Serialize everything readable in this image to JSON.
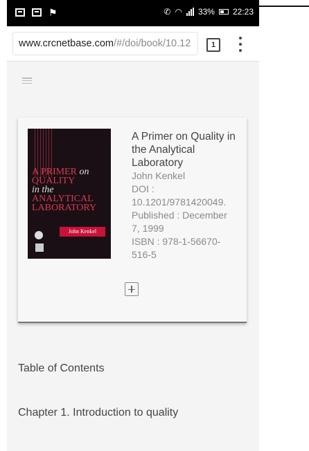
{
  "status_bar": {
    "battery": "33%",
    "time": "22:23",
    "icons": [
      "screen-icon",
      "mail-icon",
      "flag-icon",
      "phone-icon",
      "wifi-icon",
      "signal-icon",
      "battery-icon"
    ]
  },
  "browser": {
    "url_host": "www.crcnetbase.com",
    "url_path": "/#/doi/book/10.12",
    "tab_count": "1",
    "icons": [
      "menu-icon"
    ]
  },
  "book": {
    "title": "A Primer on Quality in the Analytical Laboratory",
    "author": "John Kenkel",
    "doi_label": "DOI :",
    "doi": "10.1201/9781420049.",
    "published_line1": "Published : December",
    "published_line2": "7, 1999",
    "isbn_line1": "ISBN : 978-1-56670-",
    "isbn_line2": "516-5",
    "cover": {
      "line1a": "A PRIMER",
      "line1b": " on",
      "line2": "QUALITY",
      "line3a": "in the",
      "line3b": " ANALYTICAL",
      "line4": "LABORATORY",
      "author": "John Kenkel"
    }
  },
  "sections": {
    "toc": "Table of Contents",
    "chapter1": "Chapter 1. Introduction to quality"
  }
}
